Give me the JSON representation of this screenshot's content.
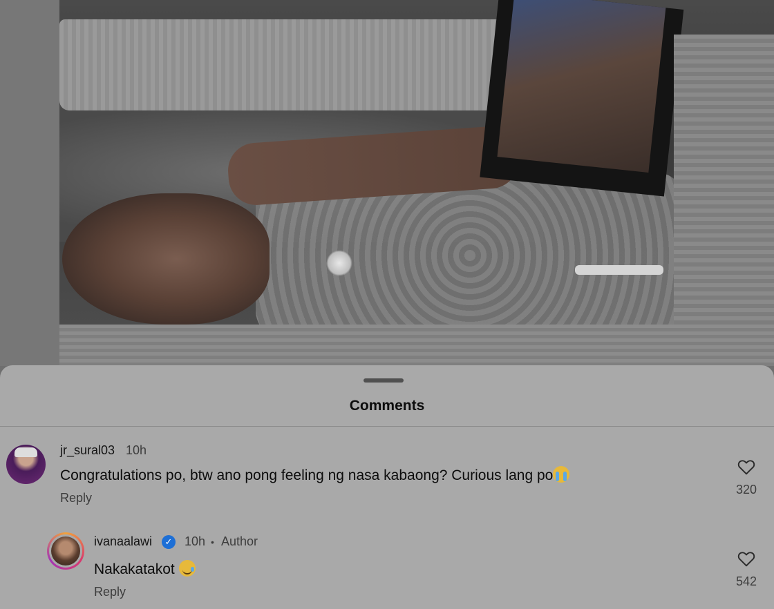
{
  "sheet": {
    "title": "Comments"
  },
  "comments": [
    {
      "username": "jr_sural03",
      "time": "10h",
      "text": "Congratulations po, btw ano pong feeling ng nasa kabaong? Curious lang po",
      "emoji": "loudly-crying-face",
      "reply_label": "Reply",
      "likes": "320"
    }
  ],
  "replies": [
    {
      "username": "ivanaalawi",
      "verified": true,
      "time": "10h",
      "separator": "•",
      "author_tag": "Author",
      "text": "Nakakatakot",
      "emoji": "smiling-face-with-tear",
      "reply_label": "Reply",
      "likes": "542"
    }
  ]
}
